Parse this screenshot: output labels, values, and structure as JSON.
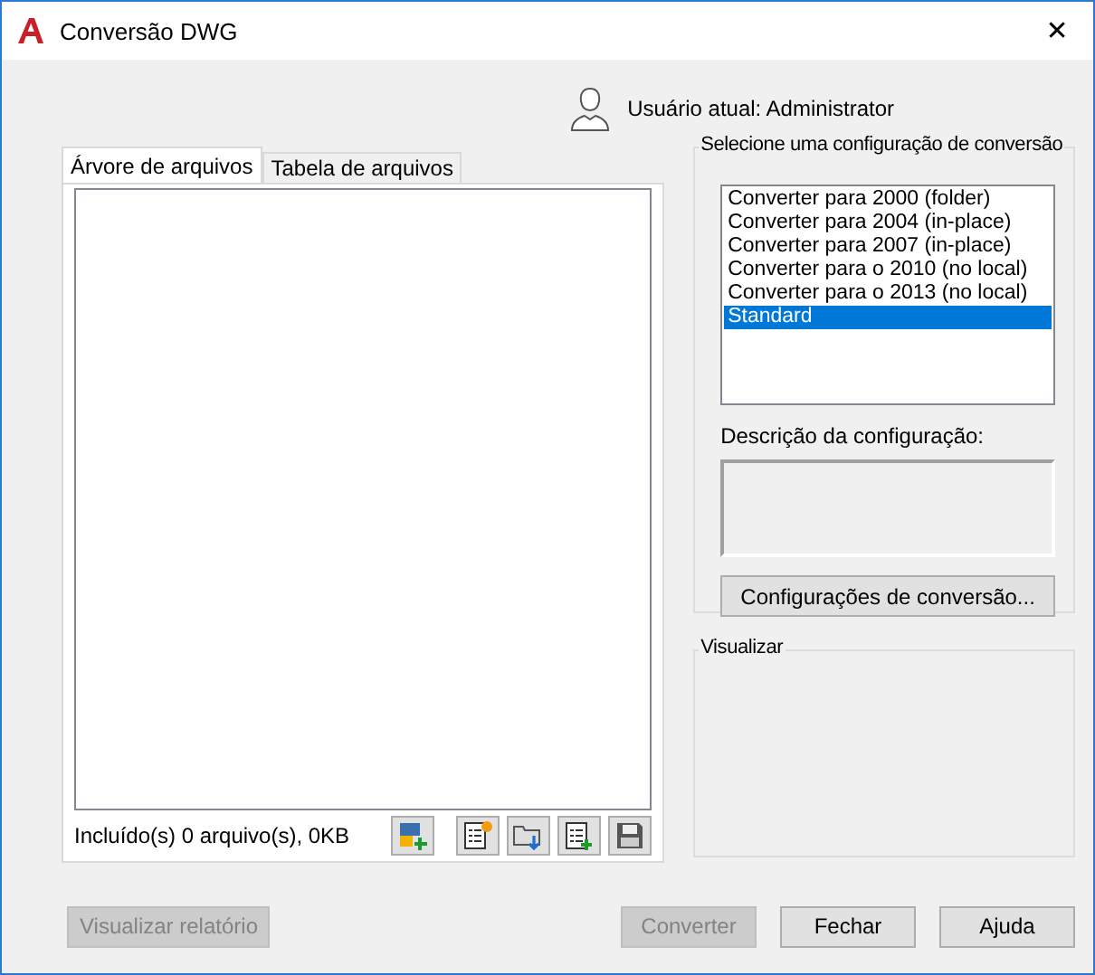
{
  "window": {
    "title": "Conversão DWG",
    "close": "✕"
  },
  "user": "Usuário atual: Administrator",
  "tabs": [
    {
      "label": "Árvore de arquivos",
      "selected": true
    },
    {
      "label": "Tabela de arquivos",
      "selected": false
    }
  ],
  "file_summary": "Incluído(s) 0 arquivo(s), 0KB",
  "config_group": {
    "title": "Selecione uma configuração de conversão",
    "items": [
      {
        "label": "Converter para 2000 (folder)",
        "selected": false
      },
      {
        "label": "Converter para 2004 (in-place)",
        "selected": false
      },
      {
        "label": "Converter para 2007 (in-place)",
        "selected": false
      },
      {
        "label": "Converter para o 2010 (no local)",
        "selected": false
      },
      {
        "label": "Converter para o 2013 (no local)",
        "selected": false
      },
      {
        "label": "Standard",
        "selected": true
      }
    ],
    "description_label": "Descrição da configuração:",
    "settings_button": "Configurações de conversão..."
  },
  "preview_group": {
    "title": "Visualizar"
  },
  "buttons": [
    {
      "label": "Visualizar relatório",
      "disabled": true
    },
    {
      "label": "Converter",
      "disabled": true
    },
    {
      "label": "Fechar",
      "disabled": false
    },
    {
      "label": "Ajuda",
      "disabled": false
    }
  ]
}
